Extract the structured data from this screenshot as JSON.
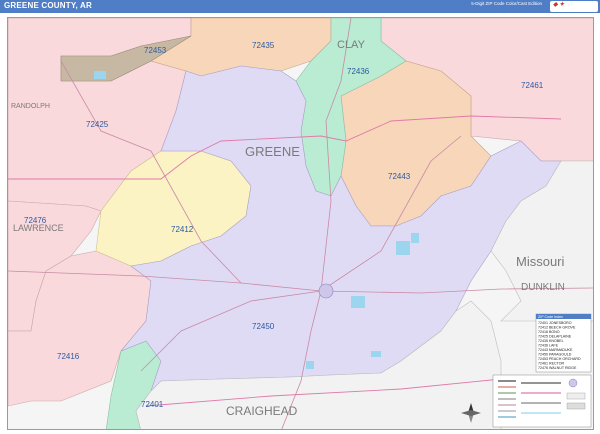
{
  "header": {
    "title": "GREENE COUNTY, AR",
    "subtitle": "5-Digit ZIP Code Color/Cast Edition",
    "logo": "Market MAPS"
  },
  "map": {
    "counties": {
      "greene": "GREENE",
      "clay": "CLAY",
      "randolph": "RANDOLPH",
      "lawrence": "LAWRENCE",
      "craighead": "CRAIGHEAD",
      "dunklin": "DUNKLIN"
    },
    "states": {
      "missouri": "Missouri"
    },
    "zips": [
      "72453",
      "72435",
      "72436",
      "72425",
      "72461",
      "72443",
      "72476",
      "72412",
      "72450",
      "72416",
      "72401"
    ],
    "colors": {
      "lavender": "#e0dbf5",
      "pink": "#f9d9dc",
      "peach": "#f7d6ba",
      "mint": "#b9ecd3",
      "yellow": "#fbf3c4",
      "brown": "#c7b8a3",
      "water": "#9bd5ee",
      "header": "#4f7ec7",
      "label": "#2c5aa0"
    }
  },
  "legend": {
    "rows": [
      "ZIP Code Index",
      "72401 JONESBORO",
      "72412 BEECH GROVE",
      "72416 BONO",
      "72425 DELAPLAINE",
      "72435 KNOBEL",
      "72436 LAFE",
      "72443 MARMADUKE",
      "72450 PARAGOULD",
      "72453 PEACH ORCHARD",
      "72461 RECTOR",
      "72476 WALNUT RIDGE"
    ]
  }
}
